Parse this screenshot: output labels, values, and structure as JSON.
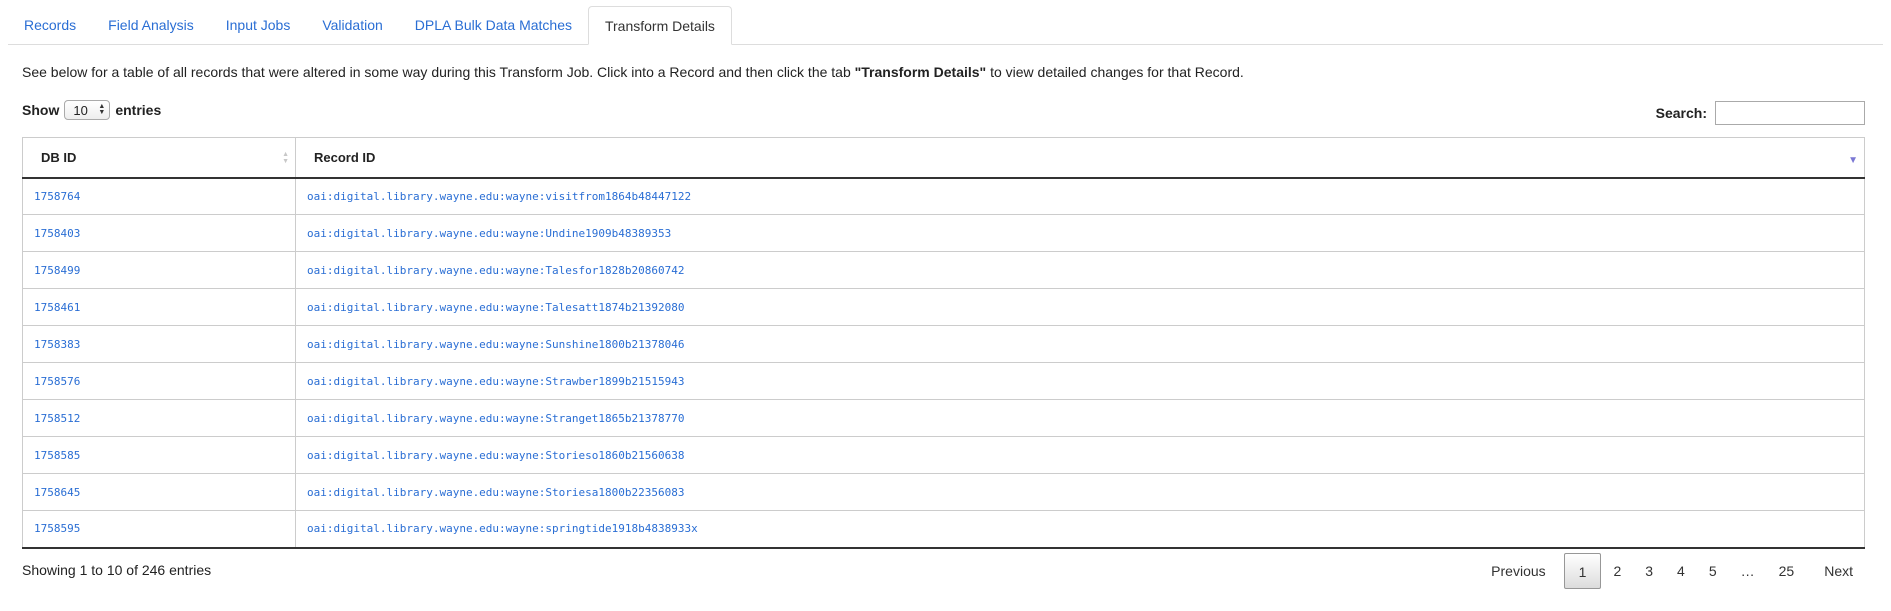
{
  "tabs": [
    {
      "label": "Records"
    },
    {
      "label": "Field Analysis"
    },
    {
      "label": "Input Jobs"
    },
    {
      "label": "Validation"
    },
    {
      "label": "DPLA Bulk Data Matches"
    },
    {
      "label": "Transform Details",
      "active": true
    }
  ],
  "description": {
    "before": "See below for a table of all records that were altered in some way during this Transform Job. Click into a Record and then click the tab ",
    "bold": "\"Transform Details\"",
    "after": " to view detailed changes for that Record."
  },
  "length_control": {
    "show_label": "Show",
    "selected": "10",
    "entries_label": "entries"
  },
  "search": {
    "label": "Search:",
    "value": ""
  },
  "table": {
    "headers": [
      "DB ID",
      "Record ID"
    ],
    "rows": [
      [
        "1758764",
        "oai:digital.library.wayne.edu:wayne:visitfrom1864b48447122"
      ],
      [
        "1758403",
        "oai:digital.library.wayne.edu:wayne:Undine1909b48389353"
      ],
      [
        "1758499",
        "oai:digital.library.wayne.edu:wayne:Talesfor1828b20860742"
      ],
      [
        "1758461",
        "oai:digital.library.wayne.edu:wayne:Talesatt1874b21392080"
      ],
      [
        "1758383",
        "oai:digital.library.wayne.edu:wayne:Sunshine1800b21378046"
      ],
      [
        "1758576",
        "oai:digital.library.wayne.edu:wayne:Strawber1899b21515943"
      ],
      [
        "1758512",
        "oai:digital.library.wayne.edu:wayne:Stranget1865b21378770"
      ],
      [
        "1758585",
        "oai:digital.library.wayne.edu:wayne:Storieso1860b21560638"
      ],
      [
        "1758645",
        "oai:digital.library.wayne.edu:wayne:Storiesa1800b22356083"
      ],
      [
        "1758595",
        "oai:digital.library.wayne.edu:wayne:springtide1918b4838933x"
      ]
    ]
  },
  "info": "Showing 1 to 10 of 246 entries",
  "pagination": {
    "previous": "Previous",
    "pages": [
      "1",
      "2",
      "3",
      "4",
      "5"
    ],
    "ellipsis": "…",
    "last": "25",
    "next": "Next"
  },
  "colors": {
    "link": "#2a6ed4",
    "sort_active": "#7b78d4"
  }
}
